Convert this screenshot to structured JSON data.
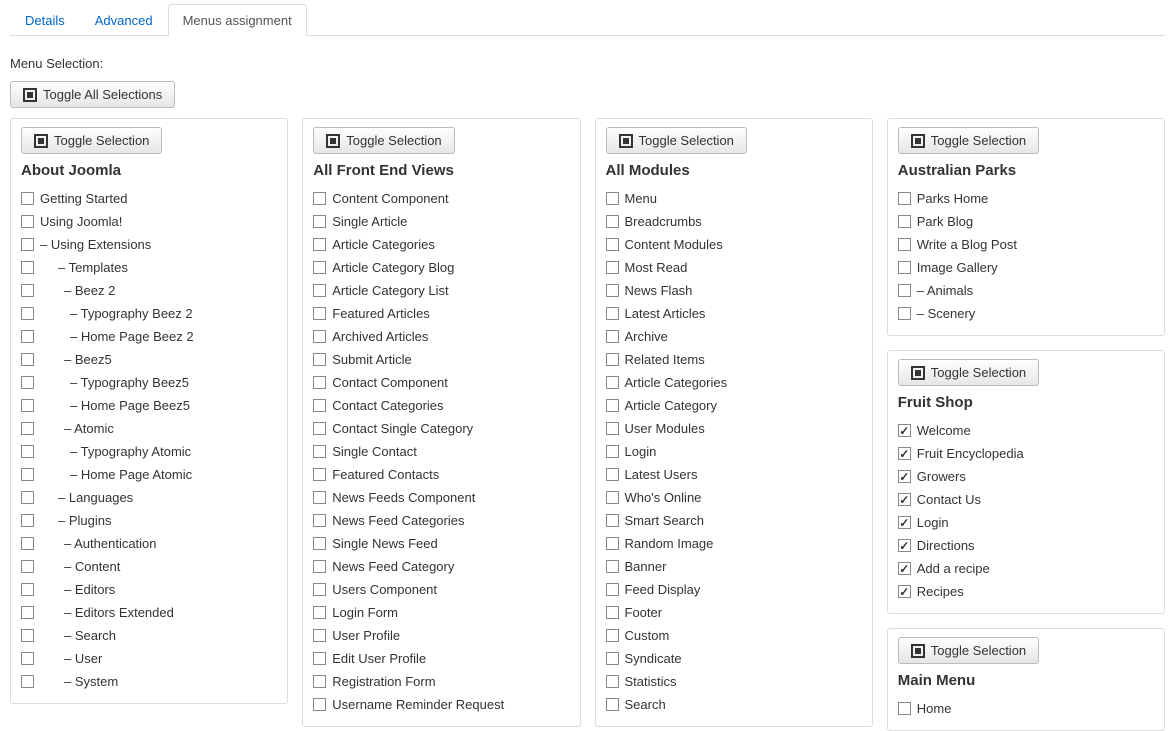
{
  "tabs": [
    {
      "label": "Details",
      "active": false
    },
    {
      "label": "Advanced",
      "active": false
    },
    {
      "label": "Menus assignment",
      "active": true
    }
  ],
  "menuSelectionLabel": "Menu Selection:",
  "toggleAllLabel": "Toggle All Selections",
  "toggleSelectionLabel": "Toggle Selection",
  "columns": [
    {
      "panels": [
        {
          "title": "About Joomla",
          "items": [
            {
              "label": "Getting Started",
              "indent": 0,
              "checked": false
            },
            {
              "label": "Using Joomla!",
              "indent": 0,
              "checked": false
            },
            {
              "label": "– Using Extensions",
              "indent": 0,
              "checked": false
            },
            {
              "label": "– Templates",
              "indent": 1,
              "checked": false
            },
            {
              "label": "– Beez 2",
              "indent": 2,
              "checked": false
            },
            {
              "label": "– Typography Beez 2",
              "indent": 3,
              "checked": false
            },
            {
              "label": "– Home Page Beez 2",
              "indent": 3,
              "checked": false
            },
            {
              "label": "– Beez5",
              "indent": 2,
              "checked": false
            },
            {
              "label": "– Typography Beez5",
              "indent": 3,
              "checked": false
            },
            {
              "label": "– Home Page Beez5",
              "indent": 3,
              "checked": false
            },
            {
              "label": "– Atomic",
              "indent": 2,
              "checked": false
            },
            {
              "label": "– Typography Atomic",
              "indent": 3,
              "checked": false
            },
            {
              "label": "– Home Page Atomic",
              "indent": 3,
              "checked": false
            },
            {
              "label": "– Languages",
              "indent": 1,
              "checked": false
            },
            {
              "label": "– Plugins",
              "indent": 1,
              "checked": false
            },
            {
              "label": "– Authentication",
              "indent": 2,
              "checked": false
            },
            {
              "label": "– Content",
              "indent": 2,
              "checked": false
            },
            {
              "label": "– Editors",
              "indent": 2,
              "checked": false
            },
            {
              "label": "– Editors Extended",
              "indent": 2,
              "checked": false
            },
            {
              "label": "– Search",
              "indent": 2,
              "checked": false
            },
            {
              "label": "– User",
              "indent": 2,
              "checked": false
            },
            {
              "label": "– System",
              "indent": 2,
              "checked": false
            }
          ]
        }
      ]
    },
    {
      "panels": [
        {
          "title": "All Front End Views",
          "items": [
            {
              "label": "Content Component",
              "indent": 0,
              "checked": false
            },
            {
              "label": "Single Article",
              "indent": 0,
              "checked": false
            },
            {
              "label": "Article Categories",
              "indent": 0,
              "checked": false
            },
            {
              "label": "Article Category Blog",
              "indent": 0,
              "checked": false
            },
            {
              "label": "Article Category List",
              "indent": 0,
              "checked": false
            },
            {
              "label": "Featured Articles",
              "indent": 0,
              "checked": false
            },
            {
              "label": "Archived Articles",
              "indent": 0,
              "checked": false
            },
            {
              "label": "Submit Article",
              "indent": 0,
              "checked": false
            },
            {
              "label": "Contact Component",
              "indent": 0,
              "checked": false
            },
            {
              "label": "Contact Categories",
              "indent": 0,
              "checked": false
            },
            {
              "label": "Contact Single Category",
              "indent": 0,
              "checked": false
            },
            {
              "label": "Single Contact",
              "indent": 0,
              "checked": false
            },
            {
              "label": "Featured Contacts",
              "indent": 0,
              "checked": false
            },
            {
              "label": "News Feeds Component",
              "indent": 0,
              "checked": false
            },
            {
              "label": "News Feed Categories",
              "indent": 0,
              "checked": false
            },
            {
              "label": "Single News Feed",
              "indent": 0,
              "checked": false
            },
            {
              "label": "News Feed Category",
              "indent": 0,
              "checked": false
            },
            {
              "label": "Users Component",
              "indent": 0,
              "checked": false
            },
            {
              "label": "Login Form",
              "indent": 0,
              "checked": false
            },
            {
              "label": "User Profile",
              "indent": 0,
              "checked": false
            },
            {
              "label": "Edit User Profile",
              "indent": 0,
              "checked": false
            },
            {
              "label": "Registration Form",
              "indent": 0,
              "checked": false
            },
            {
              "label": "Username Reminder Request",
              "indent": 0,
              "checked": false
            }
          ]
        }
      ]
    },
    {
      "panels": [
        {
          "title": "All Modules",
          "items": [
            {
              "label": "Menu",
              "indent": 0,
              "checked": false
            },
            {
              "label": "Breadcrumbs",
              "indent": 0,
              "checked": false
            },
            {
              "label": "Content Modules",
              "indent": 0,
              "checked": false
            },
            {
              "label": "Most Read",
              "indent": 0,
              "checked": false
            },
            {
              "label": "News Flash",
              "indent": 0,
              "checked": false
            },
            {
              "label": "Latest Articles",
              "indent": 0,
              "checked": false
            },
            {
              "label": "Archive",
              "indent": 0,
              "checked": false
            },
            {
              "label": "Related Items",
              "indent": 0,
              "checked": false
            },
            {
              "label": "Article Categories",
              "indent": 0,
              "checked": false
            },
            {
              "label": "Article Category",
              "indent": 0,
              "checked": false
            },
            {
              "label": "User Modules",
              "indent": 0,
              "checked": false
            },
            {
              "label": "Login",
              "indent": 0,
              "checked": false
            },
            {
              "label": "Latest Users",
              "indent": 0,
              "checked": false
            },
            {
              "label": "Who's Online",
              "indent": 0,
              "checked": false
            },
            {
              "label": "Smart Search",
              "indent": 0,
              "checked": false
            },
            {
              "label": "Random Image",
              "indent": 0,
              "checked": false
            },
            {
              "label": "Banner",
              "indent": 0,
              "checked": false
            },
            {
              "label": "Feed Display",
              "indent": 0,
              "checked": false
            },
            {
              "label": "Footer",
              "indent": 0,
              "checked": false
            },
            {
              "label": "Custom",
              "indent": 0,
              "checked": false
            },
            {
              "label": "Syndicate",
              "indent": 0,
              "checked": false
            },
            {
              "label": "Statistics",
              "indent": 0,
              "checked": false
            },
            {
              "label": "Search",
              "indent": 0,
              "checked": false
            }
          ]
        }
      ]
    },
    {
      "panels": [
        {
          "title": "Australian Parks",
          "items": [
            {
              "label": "Parks Home",
              "indent": 0,
              "checked": false
            },
            {
              "label": "Park Blog",
              "indent": 0,
              "checked": false
            },
            {
              "label": "Write a Blog Post",
              "indent": 0,
              "checked": false
            },
            {
              "label": "Image Gallery",
              "indent": 0,
              "checked": false
            },
            {
              "label": "– Animals",
              "indent": 0,
              "checked": false
            },
            {
              "label": "– Scenery",
              "indent": 0,
              "checked": false
            }
          ]
        },
        {
          "title": "Fruit Shop",
          "items": [
            {
              "label": "Welcome",
              "indent": 0,
              "checked": true
            },
            {
              "label": "Fruit Encyclopedia",
              "indent": 0,
              "checked": true
            },
            {
              "label": "Growers",
              "indent": 0,
              "checked": true
            },
            {
              "label": "Contact Us",
              "indent": 0,
              "checked": true
            },
            {
              "label": "Login",
              "indent": 0,
              "checked": true
            },
            {
              "label": "Directions",
              "indent": 0,
              "checked": true
            },
            {
              "label": "Add a recipe",
              "indent": 0,
              "checked": true
            },
            {
              "label": "Recipes",
              "indent": 0,
              "checked": true
            }
          ]
        },
        {
          "title": "Main Menu",
          "items": [
            {
              "label": "Home",
              "indent": 0,
              "checked": false
            }
          ]
        }
      ]
    }
  ]
}
